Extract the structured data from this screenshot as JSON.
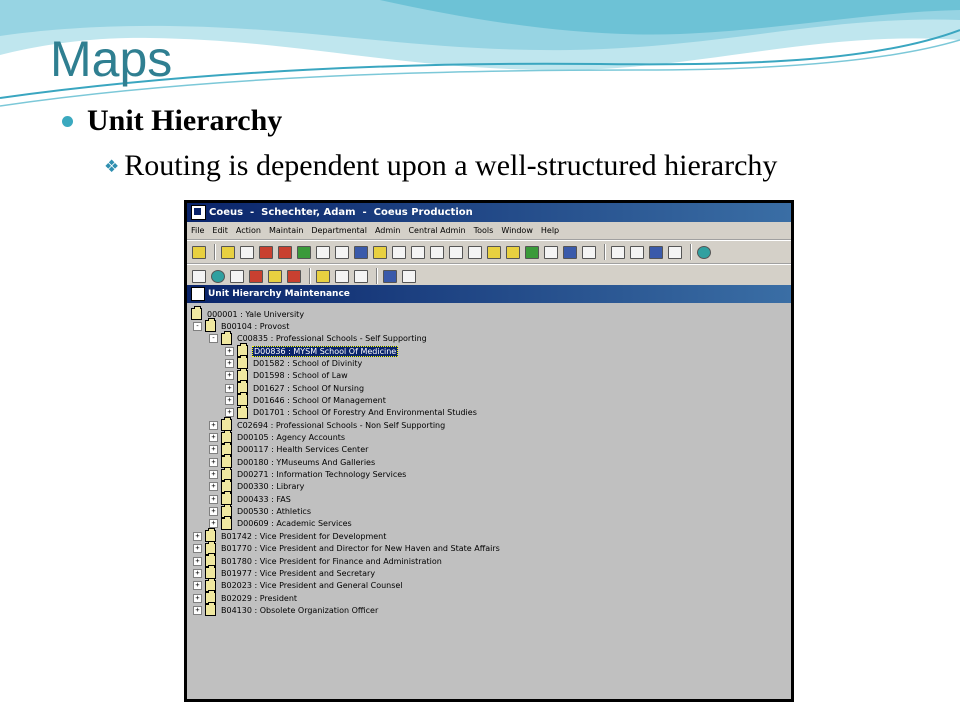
{
  "slide": {
    "title": "Maps",
    "bullet": "Unit Hierarchy",
    "subbullet": "Routing is dependent upon a well-structured hierarchy"
  },
  "app": {
    "title": "Coeus  -  Schechter, Adam  -  Coeus Production",
    "menu": [
      "File",
      "Edit",
      "Action",
      "Maintain",
      "Departmental",
      "Admin",
      "Central Admin",
      "Tools",
      "Window",
      "Help"
    ],
    "toolbar1": [
      "y",
      "y",
      "w",
      "r",
      "r",
      "g",
      "w",
      "w",
      "b",
      "y",
      "w",
      "w",
      "w",
      "w",
      "w",
      "y",
      "y",
      "g",
      "w",
      "b",
      "w",
      "w",
      "w",
      "b",
      "w",
      "t"
    ],
    "toolbar2": [
      "w",
      "t",
      "w",
      "r",
      "y",
      "r",
      "y",
      "w",
      "w",
      "b",
      "w"
    ],
    "child_title": "Unit Hierarchy Maintenance",
    "colors": {
      "titlebar": "#0a246a",
      "window_bg": "#c0c0c0",
      "selected": "#0a246a"
    }
  },
  "tree": [
    {
      "label": "000001 : Yale University",
      "level": 0,
      "exp": "",
      "selected": false
    },
    {
      "label": "B00104 : Provost",
      "level": 1,
      "exp": "-",
      "selected": false
    },
    {
      "label": "C00835 : Professional Schools - Self Supporting",
      "level": 2,
      "exp": "-",
      "selected": false
    },
    {
      "label": "D00836 : MYSM School Of Medicine",
      "level": 3,
      "exp": "+",
      "selected": true
    },
    {
      "label": "D01582 : School of Divinity",
      "level": 3,
      "exp": "+",
      "selected": false
    },
    {
      "label": "D01598 : School of Law",
      "level": 3,
      "exp": "+",
      "selected": false
    },
    {
      "label": "D01627 : School Of Nursing",
      "level": 3,
      "exp": "+",
      "selected": false
    },
    {
      "label": "D01646 : School Of Management",
      "level": 3,
      "exp": "+",
      "selected": false
    },
    {
      "label": "D01701 : School Of Forestry And Environmental Studies",
      "level": 3,
      "exp": "+",
      "selected": false
    },
    {
      "label": "C02694 : Professional Schools - Non Self Supporting",
      "level": 2,
      "exp": "+",
      "selected": false
    },
    {
      "label": "D00105 : Agency Accounts",
      "level": 2,
      "exp": "+",
      "selected": false
    },
    {
      "label": "D00117 : Health Services Center",
      "level": 2,
      "exp": "+",
      "selected": false
    },
    {
      "label": "D00180 : YMuseums And Galleries",
      "level": 2,
      "exp": "+",
      "selected": false
    },
    {
      "label": "D00271 : Information Technology Services",
      "level": 2,
      "exp": "+",
      "selected": false
    },
    {
      "label": "D00330 : Library",
      "level": 2,
      "exp": "+",
      "selected": false
    },
    {
      "label": "D00433 : FAS",
      "level": 2,
      "exp": "+",
      "selected": false
    },
    {
      "label": "D00530 : Athletics",
      "level": 2,
      "exp": "+",
      "selected": false
    },
    {
      "label": "D00609 : Academic Services",
      "level": 2,
      "exp": "+",
      "selected": false
    },
    {
      "label": "B01742 : Vice President for Development",
      "level": 1,
      "exp": "+",
      "selected": false
    },
    {
      "label": "B01770 : Vice President and Director for New Haven and State Affairs",
      "level": 1,
      "exp": "+",
      "selected": false
    },
    {
      "label": "B01780 : Vice President for Finance and Administration",
      "level": 1,
      "exp": "+",
      "selected": false
    },
    {
      "label": "B01977 : Vice President and Secretary",
      "level": 1,
      "exp": "+",
      "selected": false
    },
    {
      "label": "B02023 : Vice President and General Counsel",
      "level": 1,
      "exp": "+",
      "selected": false
    },
    {
      "label": "B02029 : President",
      "level": 1,
      "exp": "+",
      "selected": false
    },
    {
      "label": "B04130 : Obsolete Organization Officer",
      "level": 1,
      "exp": "+",
      "selected": false
    }
  ]
}
